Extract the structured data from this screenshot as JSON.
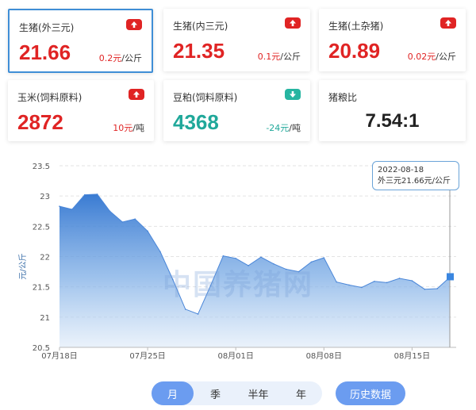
{
  "cards": [
    {
      "title": "生猪(外三元)",
      "price": "21.66",
      "change": "0.2元",
      "unit": "/公斤",
      "trend": "up",
      "selected": true
    },
    {
      "title": "生猪(内三元)",
      "price": "21.35",
      "change": "0.1元",
      "unit": "/公斤",
      "trend": "up",
      "selected": false
    },
    {
      "title": "生猪(土杂猪)",
      "price": "20.89",
      "change": "0.02元",
      "unit": "/公斤",
      "trend": "up",
      "selected": false
    },
    {
      "title": "玉米(饲料原料)",
      "price": "2872",
      "change": "10元",
      "unit": "/吨",
      "trend": "up",
      "selected": false
    },
    {
      "title": "豆粕(饲料原料)",
      "price": "4368",
      "change": "-24元",
      "unit": "/吨",
      "trend": "down",
      "selected": false
    },
    {
      "title": "猪粮比",
      "price": "7.54:1"
    }
  ],
  "colors": {
    "up": "#e02424",
    "down": "#20a89a",
    "accent": "#6b9cf0",
    "line": "#4a86d8"
  },
  "tooltip": {
    "date": "2022-08-18",
    "text": "外三元21.66元/公斤"
  },
  "watermark": "中国养猪网",
  "period_tabs": [
    {
      "label": "月",
      "active": true
    },
    {
      "label": "季",
      "active": false
    },
    {
      "label": "半年",
      "active": false
    },
    {
      "label": "年",
      "active": false
    }
  ],
  "history_button": "历史数据",
  "chart_data": {
    "type": "area",
    "title": "",
    "xlabel": "",
    "ylabel": "元/公斤",
    "ylim": [
      20.5,
      23.5
    ],
    "yticks": [
      "20.5",
      "21",
      "21.5",
      "22",
      "22.5",
      "23",
      "23.5"
    ],
    "xticks": [
      "07月18日",
      "07月25日",
      "08月01日",
      "08月08日",
      "08月15日"
    ],
    "grid": true,
    "series": [
      {
        "name": "外三元",
        "x": [
          "07-18",
          "07-19",
          "07-20",
          "07-21",
          "07-22",
          "07-23",
          "07-24",
          "07-25",
          "07-26",
          "07-27",
          "07-28",
          "07-29",
          "07-30",
          "07-31",
          "08-01",
          "08-02",
          "08-03",
          "08-04",
          "08-05",
          "08-06",
          "08-07",
          "08-08",
          "08-09",
          "08-10",
          "08-11",
          "08-12",
          "08-13",
          "08-14",
          "08-15",
          "08-16",
          "08-17",
          "08-18"
        ],
        "values": [
          22.83,
          22.78,
          23.02,
          23.03,
          22.75,
          22.57,
          22.62,
          22.42,
          22.08,
          21.62,
          21.13,
          21.05,
          21.52,
          22.01,
          21.97,
          21.85,
          21.99,
          21.88,
          21.79,
          21.75,
          21.91,
          21.98,
          21.58,
          21.53,
          21.49,
          21.59,
          21.57,
          21.64,
          21.6,
          21.46,
          21.47,
          21.66
        ]
      }
    ]
  }
}
